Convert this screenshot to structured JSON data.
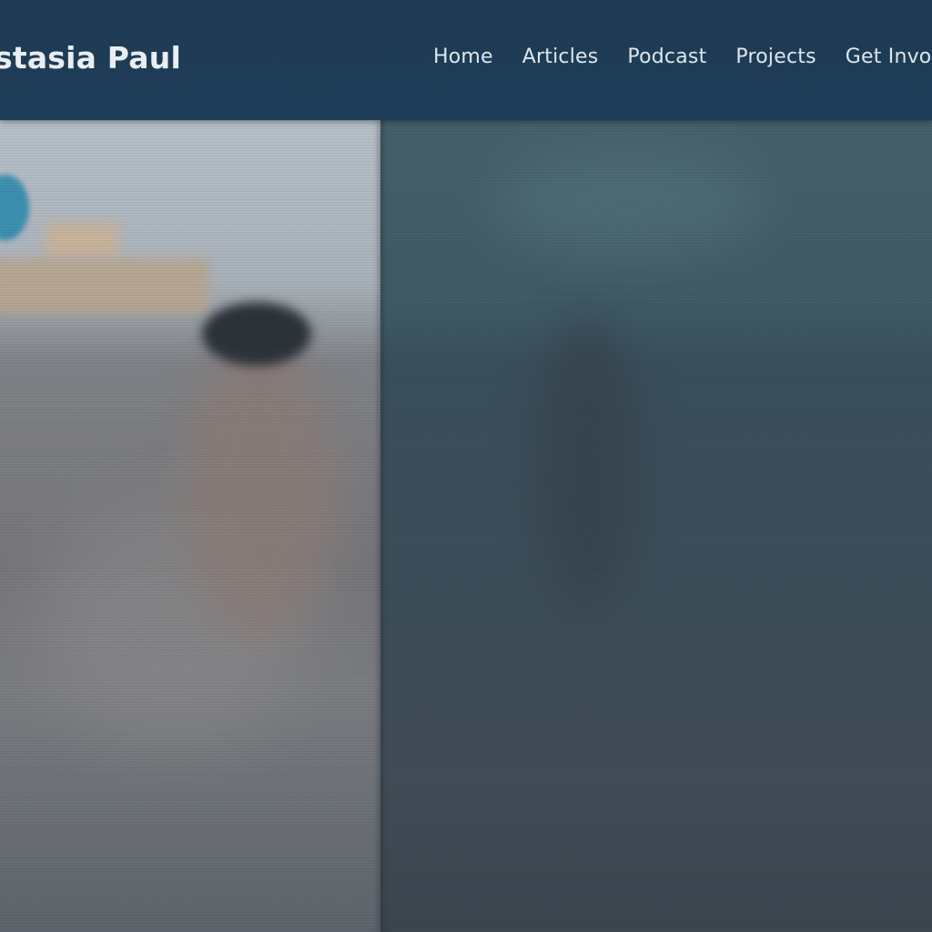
{
  "header": {
    "site_title": "stasia Paul",
    "nav": [
      {
        "label": "Home"
      },
      {
        "label": "Articles"
      },
      {
        "label": "Podcast"
      },
      {
        "label": "Projects"
      },
      {
        "label": "Get Invo"
      }
    ]
  },
  "colors": {
    "header_background": "#1f3a54",
    "header_text": "#e9eef3"
  }
}
